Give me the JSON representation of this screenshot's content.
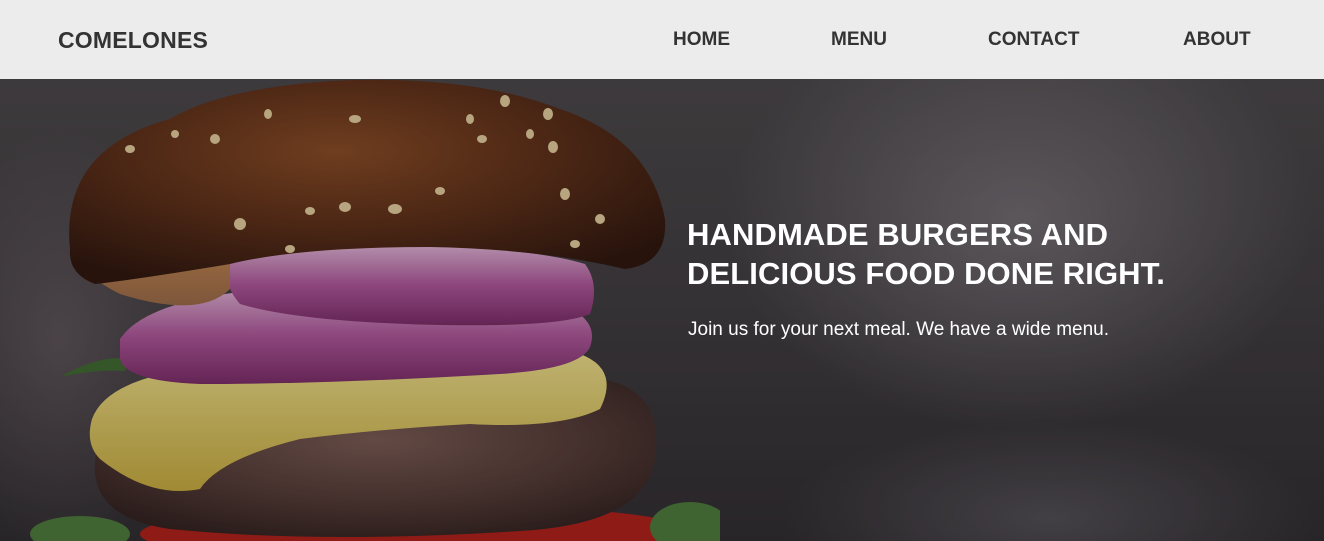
{
  "header": {
    "logo": "COMELONES",
    "nav": [
      {
        "label": "HOME"
      },
      {
        "label": "MENU"
      },
      {
        "label": "CONTACT"
      },
      {
        "label": "ABOUT"
      }
    ]
  },
  "hero": {
    "title_line1": "HANDMADE BURGERS AND",
    "title_line2": "DELICIOUS FOOD DONE RIGHT.",
    "subtitle": "Join us for your next meal. We have a wide menu.",
    "image": "burger-photo"
  },
  "colors": {
    "header_bg": "#ececec",
    "header_text": "#333333",
    "hero_text": "#ffffff"
  }
}
